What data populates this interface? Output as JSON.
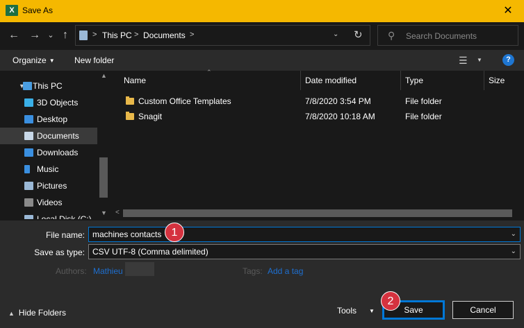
{
  "window": {
    "title": "Save As",
    "app_icon_letter": "X",
    "close_glyph": "✕"
  },
  "nav": {
    "back": "←",
    "forward": "→",
    "recent": "⌄",
    "up": "↑",
    "breadcrumbs": [
      "This PC",
      "Documents"
    ],
    "search_placeholder": "Search Documents"
  },
  "toolbar": {
    "organize": "Organize",
    "new_folder": "New folder",
    "help": "?"
  },
  "sidebar": {
    "items": [
      {
        "label": "This PC",
        "icon": "computer-icon",
        "color": "#4a9de0"
      },
      {
        "label": "3D Objects",
        "icon": "cube-icon",
        "color": "#3ab0e8"
      },
      {
        "label": "Desktop",
        "icon": "desktop-icon",
        "color": "#3a8fe0"
      },
      {
        "label": "Documents",
        "icon": "document-icon",
        "color": "#c8d8e8",
        "selected": true
      },
      {
        "label": "Downloads",
        "icon": "download-icon",
        "color": "#3a8fe0"
      },
      {
        "label": "Music",
        "icon": "music-icon",
        "color": "#3a8fe0"
      },
      {
        "label": "Pictures",
        "icon": "picture-icon",
        "color": "#9ab8d6"
      },
      {
        "label": "Videos",
        "icon": "video-icon",
        "color": "#8a8a8a"
      },
      {
        "label": "Local Disk (C:)",
        "icon": "disk-icon",
        "color": "#9ab8d6"
      }
    ]
  },
  "files": {
    "columns": [
      "Name",
      "Date modified",
      "Type",
      "Size"
    ],
    "rows": [
      {
        "name": "Custom Office Templates",
        "date": "7/8/2020 3:54 PM",
        "type": "File folder"
      },
      {
        "name": "Snagit",
        "date": "7/8/2020 10:18 AM",
        "type": "File folder"
      }
    ]
  },
  "form": {
    "filename_label": "File name:",
    "filename_value": "machines contacts",
    "savetype_label": "Save as type:",
    "savetype_value": "CSV UTF-8 (Comma delimited)",
    "authors_label": "Authors:",
    "authors_value": "Mathieu",
    "tags_label": "Tags:",
    "tags_value": "Add a tag"
  },
  "footer": {
    "hide_folders": "Hide Folders",
    "tools": "Tools",
    "save": "Save",
    "cancel": "Cancel"
  },
  "markers": [
    "1",
    "2"
  ],
  "colors": {
    "titlebar": "#f5b800",
    "accent": "#0078d7",
    "marker": "#d5323f",
    "link": "#1e6fd0"
  }
}
